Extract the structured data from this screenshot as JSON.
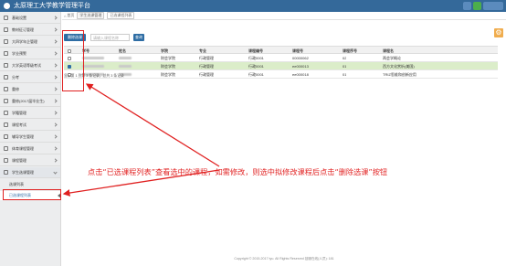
{
  "app": {
    "title": "太原理工大学教学管理平台"
  },
  "sidebar": {
    "items": [
      {
        "label": "基础设置",
        "icon": "grid-icon"
      },
      {
        "label": "教材征订管理",
        "icon": "book-icon"
      },
      {
        "label": "大四学年企管理",
        "icon": "users-icon"
      },
      {
        "label": "学业预警",
        "icon": "alert-icon"
      },
      {
        "label": "大学英语等级考试",
        "icon": "edit-icon"
      },
      {
        "label": "分考",
        "icon": "list-icon"
      },
      {
        "label": "重修",
        "icon": "folder-icon"
      },
      {
        "label": "重修(2017届毕业生)",
        "icon": "folder-icon"
      },
      {
        "label": "学籍管理",
        "icon": "folder-icon"
      },
      {
        "label": "课程考试",
        "icon": "folder-icon"
      },
      {
        "label": "辅导学生管理",
        "icon": "folder-icon"
      },
      {
        "label": "体育课程管理",
        "icon": "folder-icon"
      },
      {
        "label": "课程管理",
        "icon": "folder-icon"
      },
      {
        "label": "学生选课管理",
        "icon": "folder-icon"
      }
    ],
    "sub_items": [
      {
        "label": "选课列表"
      },
      {
        "label": "已选课程列表"
      }
    ]
  },
  "breadcrumb": {
    "home": "首页",
    "tab1": "学生选课管理",
    "tab2": "已选课程列表"
  },
  "toolbar": {
    "delete_label": "删除选课",
    "search_placeholder": "请输入课程名称",
    "search_label": "查询"
  },
  "table": {
    "columns": [
      "",
      "学号",
      "姓名",
      "学院",
      "专业",
      "课程编号",
      "课程号",
      "课程序号",
      "课程名"
    ],
    "rows": [
      {
        "selected": false,
        "college": "财会学院",
        "major": "行政管理",
        "course_code": "行政0001",
        "course_no": "00000062",
        "seq": "02",
        "course_name": "两会学概论"
      },
      {
        "selected": true,
        "college": "财会学院",
        "major": "行政管理",
        "course_code": "行政0001",
        "course_no": "ee000013",
        "seq": "01",
        "course_name": "西方文化赏析(美国)"
      },
      {
        "selected": false,
        "college": "财会学院",
        "major": "行政管理",
        "course_code": "行政0001",
        "course_no": "ee000018",
        "seq": "01",
        "course_name": "TRIZ思维和创新应用"
      }
    ]
  },
  "pager": {
    "text": "显示第 1 到第 3 条记录，总共 3 条记录"
  },
  "annotation": {
    "text": "点击“已选课程列表”查看选中的课程，如需修改，则选中拟修改课程后点击“删除选课”按钮"
  },
  "footer": {
    "text": "Copyright © 2015-2017 tyu. All Rights Reserved 技服在线(人员): 181"
  },
  "colors": {
    "header": "#34699a",
    "accent": "#2e6da4",
    "annotation": "#e22525",
    "selected_row": "#dbedc9"
  }
}
